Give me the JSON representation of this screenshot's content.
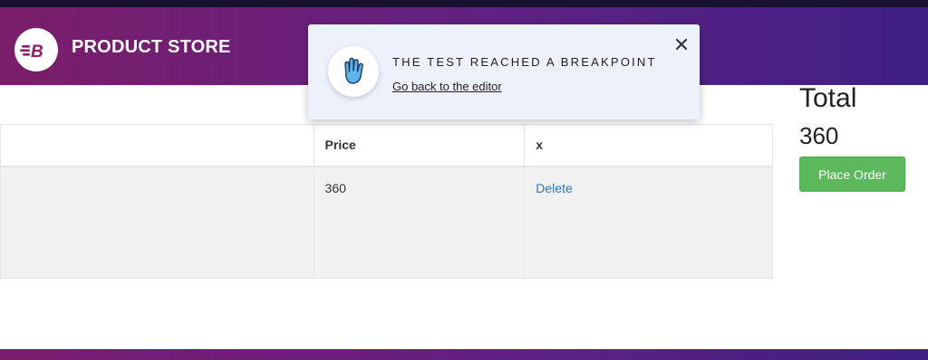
{
  "header": {
    "brand_title": "PRODUCT STORE",
    "logo_letter": "B",
    "gradient_start": "#7b1d6a",
    "gradient_end": "#3f2083"
  },
  "cart_table": {
    "columns": [
      "",
      "Price",
      "x"
    ],
    "rows": [
      {
        "title": "",
        "price": "360",
        "action": "Delete"
      }
    ]
  },
  "totals": {
    "heading": "Total",
    "value": "360",
    "place_order_label": "Place Order",
    "button_color": "#5cb85c"
  },
  "breakpoint_popup": {
    "title": "THE TEST REACHED A BREAKPOINT",
    "link": "Go back to the editor",
    "icon": "hand-stop-icon",
    "close_icon": "close-icon"
  }
}
